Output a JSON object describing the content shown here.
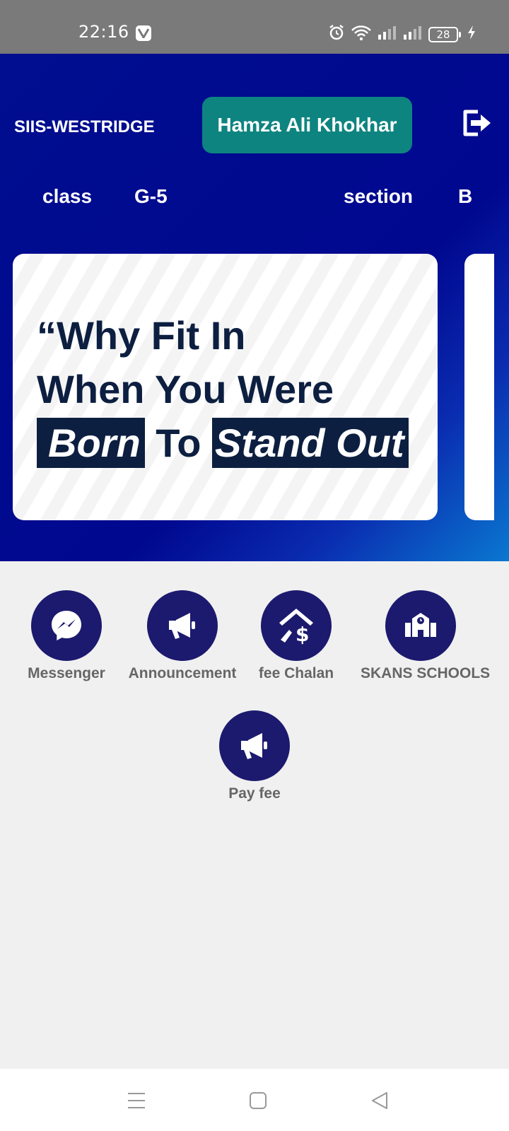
{
  "status_bar": {
    "time": "22:16",
    "battery": "28"
  },
  "header": {
    "school": "SIIS-WESTRIDGE",
    "user_name": "Hamza Ali Khokhar",
    "class_label": "class",
    "class_value": "G-5",
    "section_label": "section",
    "section_value": "B"
  },
  "banner": {
    "line1": "“Why Fit In",
    "line2": "When You Were",
    "word_born": "Born",
    "word_to": "To",
    "word_standout": "Stand Out"
  },
  "menu": {
    "messenger": "Messenger",
    "announcement": "Announcement",
    "fee_chalan": "fee Chalan",
    "skans": "SKANS SCHOOLS",
    "pay_fee": "Pay fee"
  },
  "colors": {
    "header_bg": "#000e8f",
    "pill_bg": "#0e8480",
    "icon_circle": "#1c1a6e",
    "banner_text": "#0d1f40"
  }
}
